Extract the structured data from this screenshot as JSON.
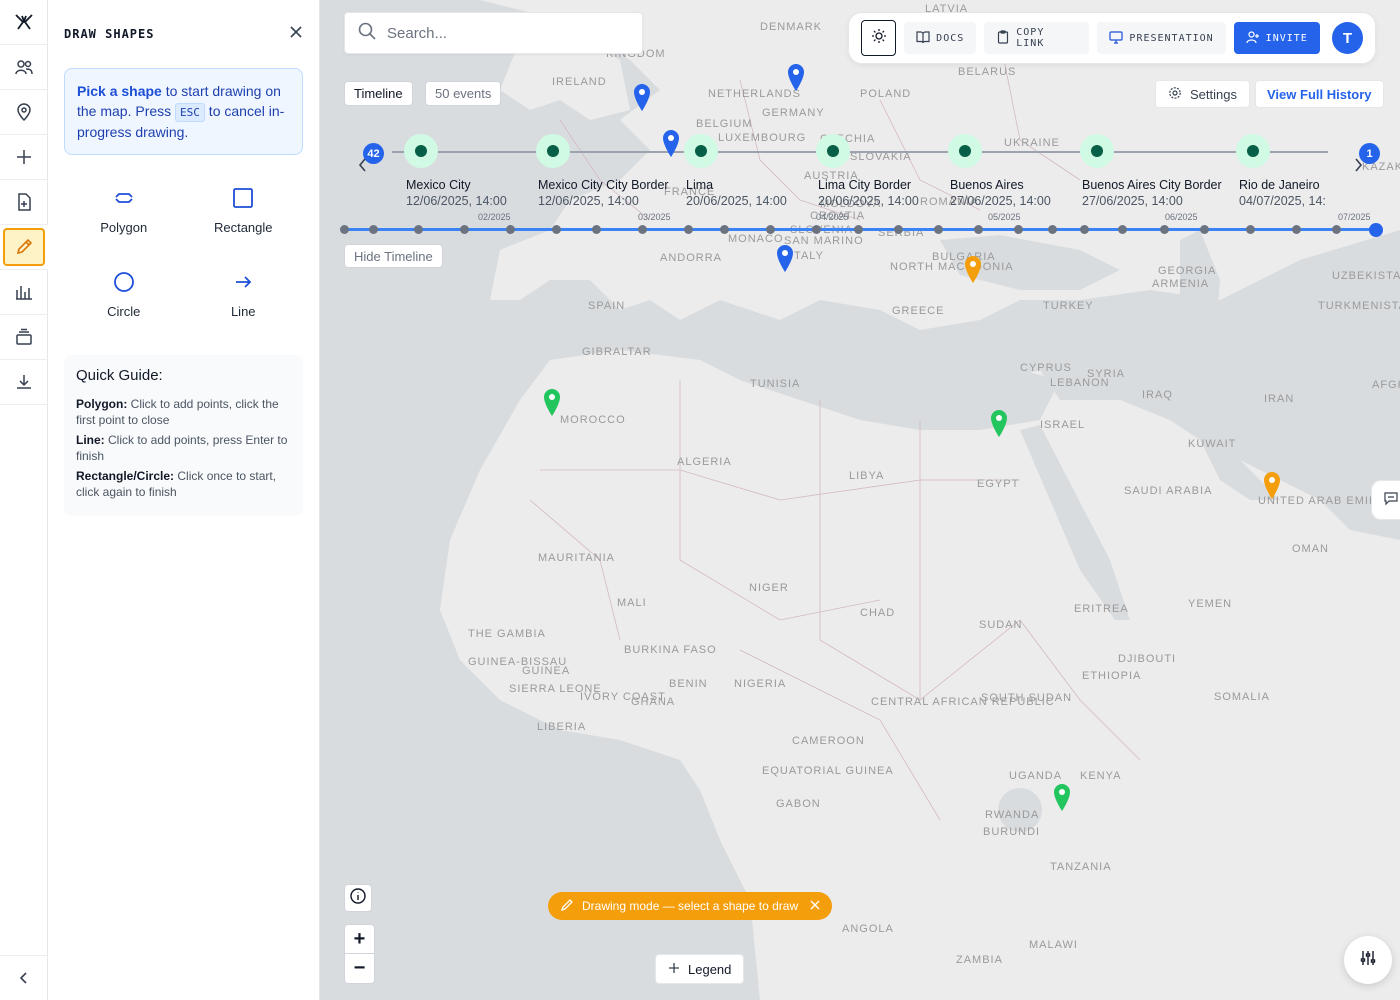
{
  "rail": {
    "items": [
      {
        "icon": "logo-icon"
      },
      {
        "icon": "users-icon"
      },
      {
        "icon": "map-pin-icon"
      },
      {
        "icon": "plus-icon"
      },
      {
        "icon": "file-add-icon"
      },
      {
        "icon": "pencil-icon",
        "active": true
      },
      {
        "icon": "bar-chart-icon"
      },
      {
        "icon": "layers-icon"
      },
      {
        "icon": "download-icon"
      }
    ],
    "collapse_icon": "chevron-left-icon"
  },
  "panel": {
    "title": "DRAW SHAPES",
    "hint": {
      "strong": "Pick a shape",
      "part1": " to start drawing on the map. Press ",
      "key": "ESC",
      "part2": " to cancel in-progress drawing."
    },
    "shapes": [
      {
        "label": "Polygon",
        "icon": "polygon-icon"
      },
      {
        "label": "Rectangle",
        "icon": "rectangle-icon"
      },
      {
        "label": "Circle",
        "icon": "circle-icon"
      },
      {
        "label": "Line",
        "icon": "arrow-right-icon"
      }
    ],
    "guide": {
      "title": "Quick Guide:",
      "items": [
        {
          "term": "Polygon:",
          "text": " Click to add points, click the first point to close"
        },
        {
          "term": "Line:",
          "text": " Click to add points, press Enter to finish"
        },
        {
          "term": "Rectangle/Circle:",
          "text": " Click once to start, click again to finish"
        }
      ]
    }
  },
  "search": {
    "placeholder": "Search..."
  },
  "topbar": {
    "docs": "DOCS",
    "copy_link": "COPY LINK",
    "presentation": "PRESENTATION",
    "invite": "INVITE",
    "avatar": "T"
  },
  "timeline": {
    "tab_label": "Timeline",
    "events_count": "50 events",
    "settings": "Settings",
    "view_history": "View Full History",
    "hide": "Hide Timeline",
    "badge_left": "42",
    "badge_right": "1",
    "events": [
      {
        "title": "Mexico City",
        "date": "12/06/2025, 14:00"
      },
      {
        "title": "Mexico City City Border",
        "date": "12/06/2025, 14:00"
      },
      {
        "title": "Lima",
        "date": "20/06/2025, 14:00"
      },
      {
        "title": "Lima City Border",
        "date": "20/06/2025, 14:00"
      },
      {
        "title": "Buenos Aires",
        "date": "27/06/2025, 14:00"
      },
      {
        "title": "Buenos Aires City Border",
        "date": "27/06/2025, 14:00"
      },
      {
        "title": "Rio de Janeiro",
        "date": "04/07/2025, 14:"
      }
    ],
    "axis_labels": [
      "02/2025",
      "03/2025",
      "04/2025",
      "05/2025",
      "06/2025",
      "07/2025"
    ]
  },
  "map": {
    "countries": [
      "LATVIA",
      "DENMARK",
      "BELARUS",
      "KINGDOM",
      "IRELAND",
      "NETHERLANDS",
      "POLAND",
      "GERMANY",
      "BELGIUM",
      "LUXEMBOURG",
      "CZECHIA",
      "UKRAINE",
      "SLOVAKIA",
      "FRANCE",
      "AUSTRIA",
      "MOLDOVA",
      "ROMANIA",
      "SLOVENIA",
      "CROATIA",
      "SERBIA",
      "MONACO",
      "SAN MARINO",
      "ANDORRA",
      "ITALY",
      "BULGARIA",
      "NORTH MACEDONIA",
      "GEORGIA",
      "ARMENIA",
      "KAZAKH",
      "UZBEKISTA",
      "SPAIN",
      "GREECE",
      "TURKEY",
      "TURKMENISTAN",
      "GIBRALTAR",
      "TUNISIA",
      "CYPRUS",
      "LEBANON",
      "SYRIA",
      "IRAQ",
      "IRAN",
      "AFGHAN",
      "MOROCCO",
      "ISRAEL",
      "KUWAIT",
      "ALGERIA",
      "LIBYA",
      "EGYPT",
      "SAUDI ARABIA",
      "UNITED ARAB EMIRATES",
      "OMAN",
      "MAURITANIA",
      "MALI",
      "NIGER",
      "CHAD",
      "SUDAN",
      "ERITREA",
      "YEMEN",
      "DJIBOUTI",
      "THE GAMBIA",
      "GUINEA-BISSAU",
      "GUINEA",
      "BURKINA FASO",
      "BENIN",
      "NIGERIA",
      "ETHIOPIA",
      "SOMALIA",
      "SIERRA LEONE",
      "IVORY COAST",
      "GHANA",
      "CENTRAL AFRICAN REPUBLIC",
      "SOUTH SUDAN",
      "LIBERIA",
      "CAMEROON",
      "EQUATORIAL GUINEA",
      "GABON",
      "UGANDA",
      "KENYA",
      "RWANDA",
      "BURUNDI",
      "TANZANIA",
      "ANGOLA",
      "MALAWI",
      "ZAMBIA"
    ],
    "pin_colors": {
      "blue": "#2563eb",
      "green": "#22c55e",
      "amber": "#f59e0b"
    }
  },
  "draw_toast": "Drawing mode — select a shape to draw",
  "legend": "Legend",
  "colors": {
    "accent": "#2563eb",
    "active": "#f59e0b",
    "event_dot": "#065f46"
  }
}
